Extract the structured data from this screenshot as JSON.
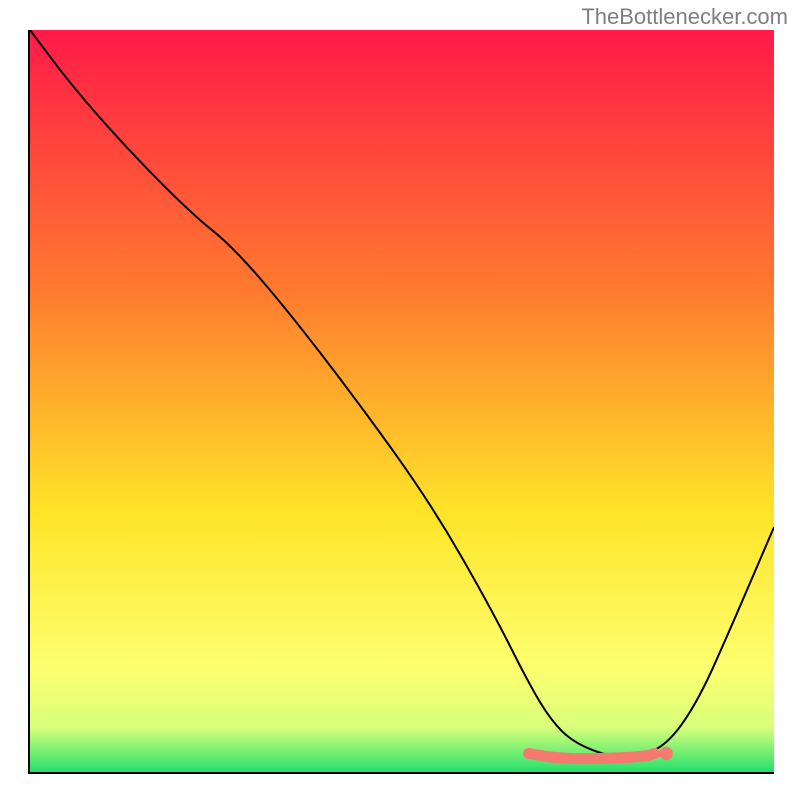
{
  "attribution": "TheBottlenecker.com",
  "chart_data": {
    "type": "line",
    "title": "",
    "xlabel": "",
    "ylabel": "",
    "xlim": [
      0,
      100
    ],
    "ylim": [
      0,
      100
    ],
    "gradient_stops": [
      {
        "offset": 0,
        "color": "#ff1a48"
      },
      {
        "offset": 35,
        "color": "#ff7a2f"
      },
      {
        "offset": 65,
        "color": "#ffe428"
      },
      {
        "offset": 86,
        "color": "#fdff70"
      },
      {
        "offset": 94,
        "color": "#d8ff7a"
      },
      {
        "offset": 100,
        "color": "#25e06c"
      }
    ],
    "series": [
      {
        "name": "bottleneck-curve",
        "color": "#000000",
        "type": "line",
        "x": [
          0,
          6,
          14,
          22,
          27,
          34,
          44,
          54,
          62,
          67,
          70,
          73,
          78,
          82,
          86,
          90,
          94,
          97,
          100
        ],
        "y": [
          100,
          92,
          83,
          75,
          71,
          63,
          50,
          36,
          22,
          12,
          7,
          4,
          2,
          2,
          4,
          10,
          19,
          26,
          33
        ]
      },
      {
        "name": "recommended-range",
        "color": "#f47a70",
        "type": "line",
        "x": [
          67,
          70,
          73,
          76,
          79,
          81,
          83,
          84
        ],
        "y": [
          2.5,
          2.0,
          1.8,
          1.8,
          1.9,
          2.0,
          2.2,
          2.5
        ]
      }
    ],
    "marker": {
      "name": "recommended-point",
      "color": "#f47a70",
      "x": 85.5,
      "y": 2.5,
      "r": 5
    }
  }
}
